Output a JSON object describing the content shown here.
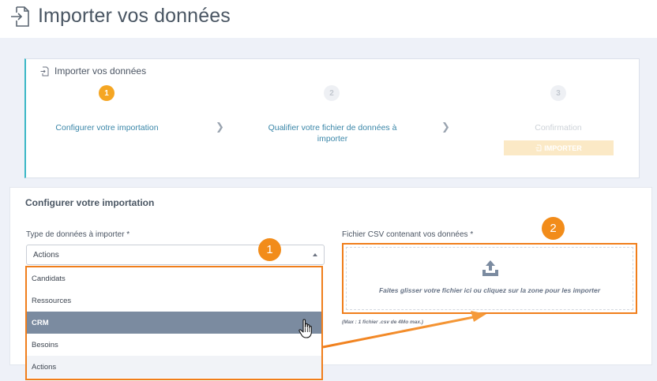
{
  "page": {
    "title": "Importer vos données",
    "header_icon": "file-import-icon"
  },
  "wizard": {
    "heading": "Importer vos données",
    "heading_icon": "file-import-icon",
    "steps": [
      {
        "number": "1",
        "label": "Configurer votre importation",
        "state": "active"
      },
      {
        "number": "2",
        "label": "Qualifier votre fichier de données à importer",
        "state": "upcoming"
      },
      {
        "number": "3",
        "label": "Confirmation",
        "state": "disabled"
      }
    ],
    "import_button": "IMPORTER",
    "accent_color": "#f5a623",
    "link_color": "#3a86a8"
  },
  "config": {
    "title": "Configurer votre importation",
    "type_label": "Type de données à importer *",
    "type_value": "Actions",
    "file_label": "Fichier CSV contenant vos données *",
    "dropzone_text": "Faites glisser votre fichier ici ou cliquez sur la zone pour les importer",
    "dropzone_icon": "upload-tray-icon",
    "dropzone_hint": "(Max : 1 fichier .csv de 4Mo max.)"
  },
  "dropdown": {
    "options": [
      "Candidats",
      "Ressources",
      "CRM",
      "Besoins",
      "Actions"
    ],
    "highlighted": "CRM",
    "current": "Actions"
  },
  "annotations": {
    "badge_1": "1",
    "badge_2": "2",
    "highlight_color": "#f07e1b"
  }
}
